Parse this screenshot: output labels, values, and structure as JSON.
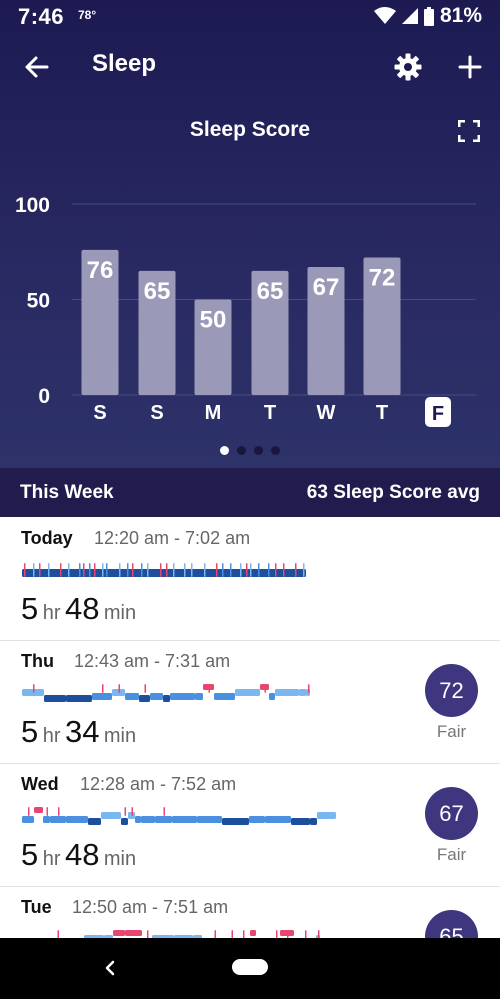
{
  "status": {
    "time": "7:46",
    "temp": "78°",
    "battery": "81%"
  },
  "header": {
    "title": "Sleep",
    "back_icon": "arrow-left-icon",
    "settings_icon": "gear-icon",
    "add_icon": "plus-icon"
  },
  "chart_title": "Sleep Score",
  "chart_data": {
    "type": "bar",
    "title": "Sleep Score",
    "categories": [
      "S",
      "S",
      "M",
      "T",
      "W",
      "T",
      "F"
    ],
    "values": [
      76,
      65,
      50,
      65,
      67,
      72,
      null
    ],
    "yticks": [
      "100",
      "50",
      "0"
    ],
    "ylim": [
      0,
      100
    ],
    "grid": true,
    "bar_color": "#9b99b8",
    "highlight_category": "F",
    "grid_color": "#4a4a7a"
  },
  "pager": {
    "count": 4,
    "active": 0
  },
  "week": {
    "label": "This Week",
    "avg": "63 Sleep Score avg"
  },
  "entries": [
    {
      "day": "Today",
      "range": "12:20 am - 7:02 am",
      "hours": "5",
      "hr_unit": "hr",
      "minutes": "48",
      "min_unit": "min",
      "score": "",
      "grade": ""
    },
    {
      "day": "Thu",
      "range": "12:43 am - 7:31 am",
      "hours": "5",
      "hr_unit": "hr",
      "minutes": "34",
      "min_unit": "min",
      "score": "72",
      "grade": "Fair"
    },
    {
      "day": "Wed",
      "range": "12:28 am - 7:52 am",
      "hours": "5",
      "hr_unit": "hr",
      "minutes": "48",
      "min_unit": "min",
      "score": "67",
      "grade": "Fair"
    },
    {
      "day": "Tue",
      "range": "12:50 am - 7:51 am",
      "hours": "",
      "hr_unit": "",
      "minutes": "",
      "min_unit": "",
      "score": "65",
      "grade": ""
    }
  ],
  "colors": {
    "awake": "#e8456f",
    "rem": "#7ab6f0",
    "light": "#4a8fe0",
    "deep": "#1d4f9c",
    "badge": "#3f3680"
  }
}
